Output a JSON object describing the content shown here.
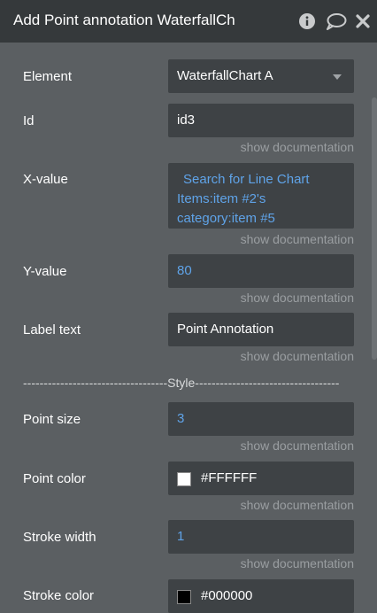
{
  "header": {
    "title": "Add Point annotation WaterfallCh",
    "icons": [
      "info-icon",
      "comment-icon",
      "close-icon"
    ]
  },
  "fields": {
    "element": {
      "label": "Element",
      "value": "WaterfallChart A"
    },
    "id": {
      "label": "Id",
      "value": "id3",
      "doc": "show documentation"
    },
    "x_value": {
      "label": "X-value",
      "line1": "Search for Line Chart",
      "line2": "Items:item #2's",
      "line3": "category:item #5",
      "doc": "show documentation"
    },
    "y_value": {
      "label": "Y-value",
      "value": "80",
      "doc": "show documentation"
    },
    "label_text": {
      "label": "Label text",
      "value": "Point Annotation",
      "doc": "show documentation"
    },
    "style_divider": "-----------------------------------Style-----------------------------------",
    "point_size": {
      "label": "Point size",
      "value": "3",
      "doc": "show documentation"
    },
    "point_color": {
      "label": "Point color",
      "value": "#FFFFFF",
      "swatch": "#FFFFFF",
      "doc": "show documentation"
    },
    "stroke_width": {
      "label": "Stroke width",
      "value": "1",
      "doc": "show documentation"
    },
    "stroke_color": {
      "label": "Stroke color",
      "value": "#000000",
      "swatch": "#000000"
    }
  },
  "colors": {
    "header_bg": "#35393b",
    "panel_bg": "#5b5f62",
    "field_bg": "#3e4245",
    "dynamic_text": "#5fa3e8",
    "doc_text": "#9a9ea1"
  }
}
